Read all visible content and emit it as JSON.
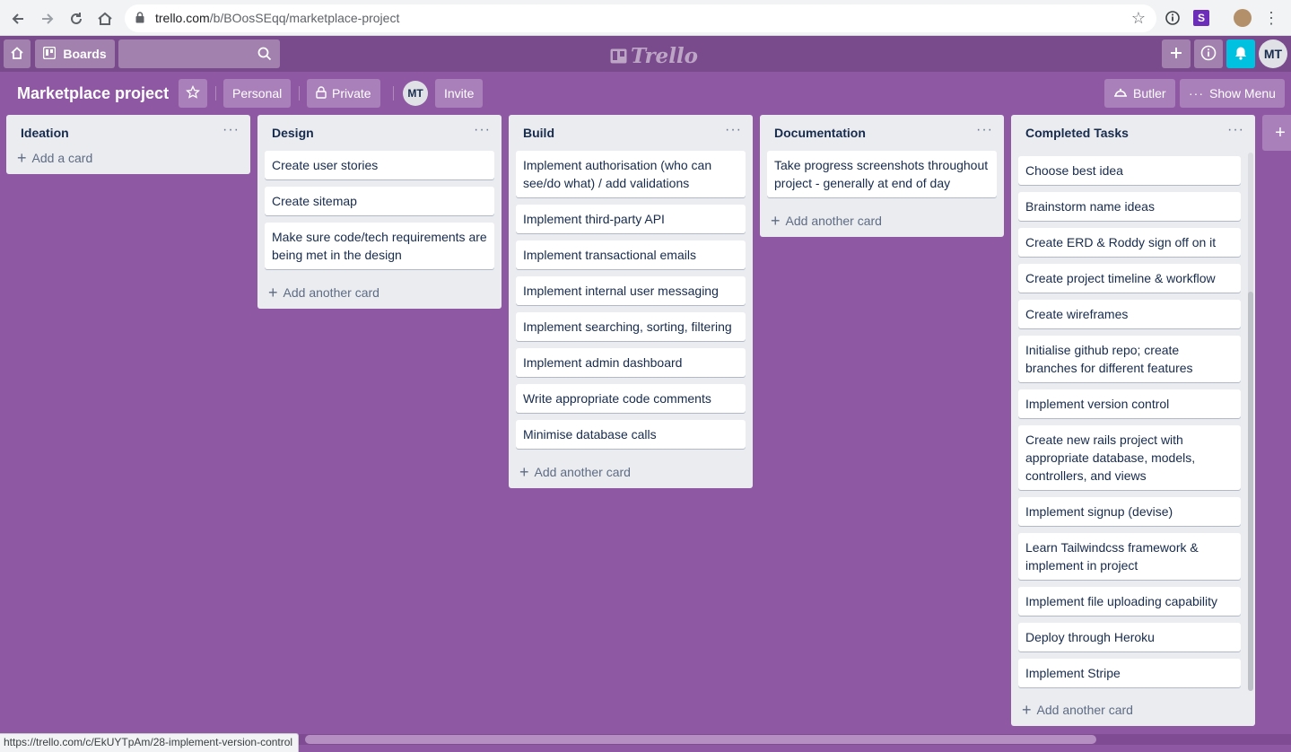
{
  "browser": {
    "url_domain": "trello.com",
    "url_path": "/b/BOosSEqq/marketplace-project",
    "status_url": "https://trello.com/c/EkUYTpAm/28-implement-version-control",
    "extension_letter": "S"
  },
  "header": {
    "boards_label": "Boards",
    "logo_text": "Trello",
    "avatar_initials": "MT"
  },
  "board": {
    "title": "Marketplace project",
    "team_label": "Personal",
    "visibility_label": "Private",
    "member_initials": "MT",
    "invite_label": "Invite",
    "butler_label": "Butler",
    "show_menu_label": "Show Menu"
  },
  "lists": [
    {
      "title": "Ideation",
      "cards": [],
      "add_label": "Add a card"
    },
    {
      "title": "Design",
      "cards": [
        "Create user stories",
        "Create sitemap",
        "Make sure code/tech requirements are being met in the design"
      ],
      "add_label": "Add another card"
    },
    {
      "title": "Build",
      "cards": [
        "Implement authorisation (who can see/do what) / add validations",
        "Implement third-party API",
        "Implement transactional emails",
        "Implement internal user messaging",
        "Implement searching, sorting, filtering",
        "Implement admin dashboard",
        "Write appropriate code comments",
        "Minimise database calls"
      ],
      "add_label": "Add another card"
    },
    {
      "title": "Documentation",
      "cards": [
        "Take progress screenshots throughout project - generally at end of day"
      ],
      "add_label": "Add another card"
    },
    {
      "title": "Completed Tasks",
      "cards": [
        "Choose best idea",
        "Brainstorm name ideas",
        "Create ERD & Roddy sign off on it",
        "Create project timeline & workflow",
        "Create wireframes",
        "Initialise github repo; create branches for different features",
        "Implement version control",
        "Create new rails project with appropriate database, models, controllers, and views",
        "Implement signup (devise)",
        "Learn Tailwindcss framework & implement in project",
        "Implement file uploading capability",
        "Deploy through Heroku",
        "Implement Stripe"
      ],
      "add_label": "Add another card"
    }
  ],
  "icons": [
    "back-icon",
    "forward-icon",
    "reload-icon",
    "home-icon",
    "lock-icon",
    "star-icon",
    "info-icon",
    "bell-icon",
    "plus-icon",
    "search-icon",
    "board-icon",
    "more-icon",
    "butler-icon"
  ],
  "colors": {
    "board_bg": "#8f58a3",
    "header_bg": "#7a4b8c",
    "bell_bg": "#00c2e0",
    "list_bg": "#ebecf0"
  }
}
